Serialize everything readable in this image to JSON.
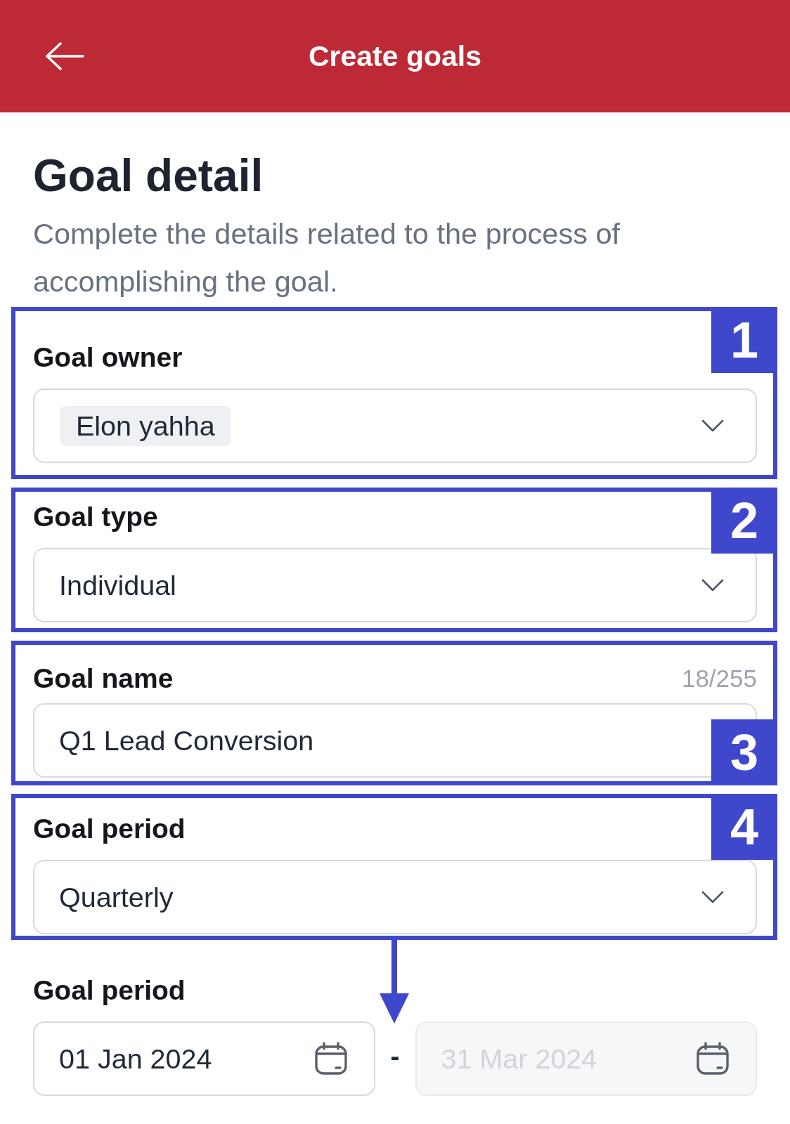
{
  "header": {
    "title": "Create goals"
  },
  "intro": {
    "heading": "Goal detail",
    "description": "Complete the details related to the process of accomplishing the goal."
  },
  "fields": [
    {
      "kind": "tag_select",
      "label": "Goal owner",
      "value": "Elon yahha",
      "callout": {
        "number": "1",
        "at_bottom": false,
        "arrow": false
      }
    },
    {
      "kind": "select",
      "label": "Goal type",
      "value": "Individual",
      "callout": {
        "number": "2",
        "at_bottom": false,
        "arrow": false
      }
    },
    {
      "kind": "text",
      "label": "Goal name",
      "counter": "18/255",
      "value": "Q1 Lead Conversion",
      "callout": {
        "number": "3",
        "at_bottom": true,
        "arrow": false
      }
    },
    {
      "kind": "select",
      "label": "Goal period",
      "value": "Quarterly",
      "callout": {
        "number": "4",
        "at_bottom": false,
        "arrow": true
      }
    },
    {
      "kind": "date_range",
      "label": "Goal period",
      "start": {
        "value": "01 Jan 2024",
        "disabled": false
      },
      "separator": "-",
      "end": {
        "value": "31 Mar 2024",
        "disabled": true
      }
    }
  ]
}
